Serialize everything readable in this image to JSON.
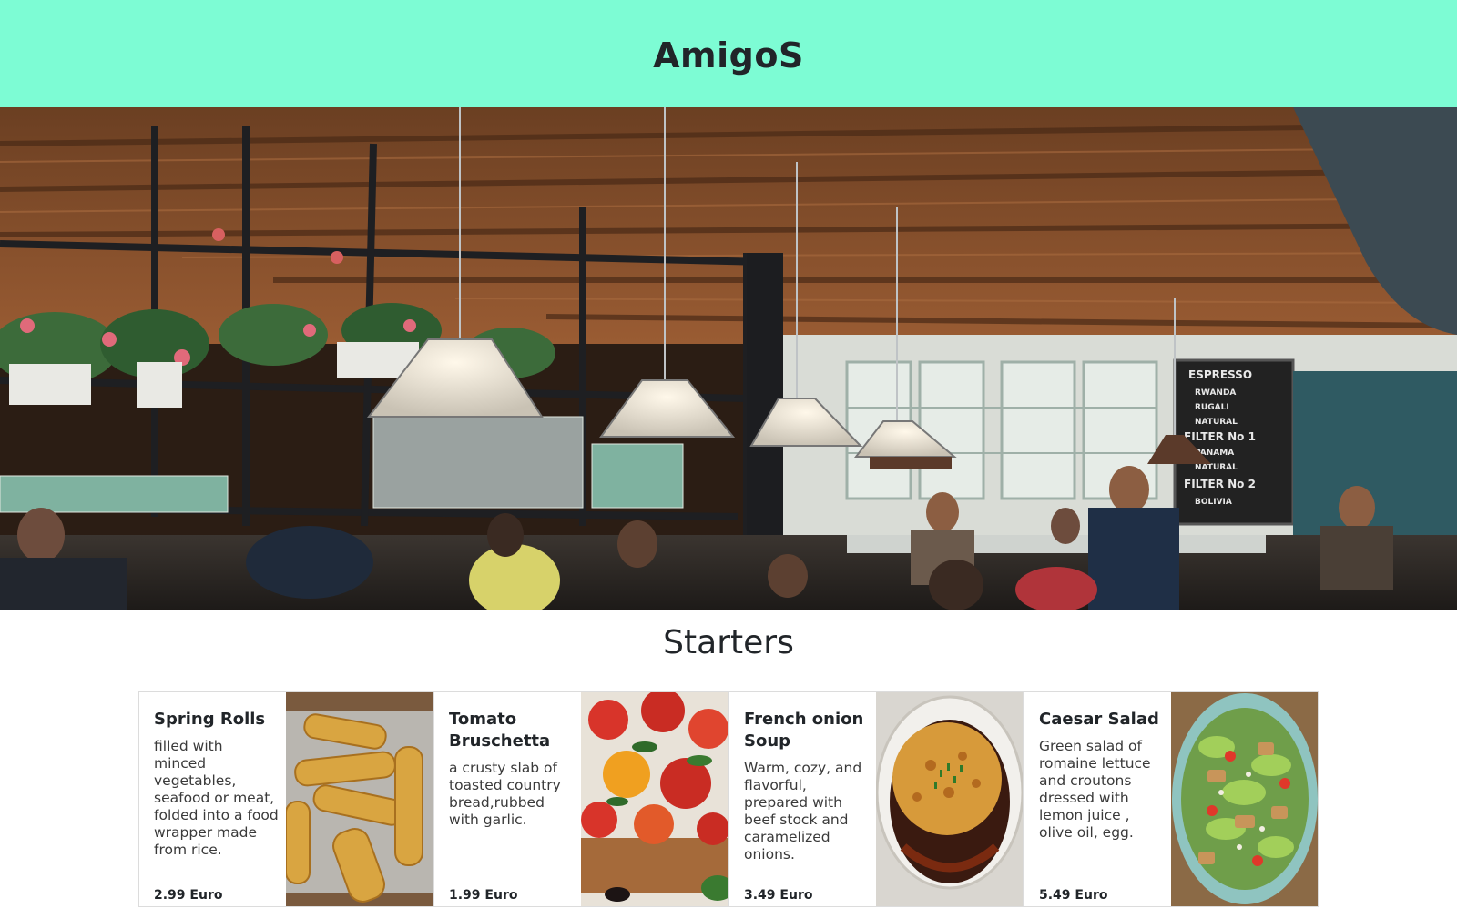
{
  "header": {
    "brand": "AmigoS"
  },
  "hero": {
    "chalkboard": [
      "ESPRESSO",
      "RWANDA",
      "RUGALI",
      "NATURAL",
      "FILTER No 1",
      "PANAMA",
      "NATURAL",
      "FILTER No 2",
      "BOLIVIA"
    ]
  },
  "section": {
    "title": "Starters"
  },
  "cards": [
    {
      "title": "Spring Rolls",
      "text": "filled with minced vegetables, seafood or meat, folded into a food wrapper made from rice.",
      "price": "2.99 Euro"
    },
    {
      "title": "Tomato Bruschetta",
      "text": "a crusty slab of toasted country bread,rubbed with garlic.",
      "price": "1.99 Euro"
    },
    {
      "title": "French onion Soup",
      "text": "Warm, cozy, and flavorful, prepared with beef stock and caramelized onions.",
      "price": "3.49 Euro"
    },
    {
      "title": "Caesar Salad",
      "text": "Green salad of romaine lettuce and croutons dressed with lemon juice , olive oil, egg.",
      "price": "5.49 Euro"
    }
  ]
}
